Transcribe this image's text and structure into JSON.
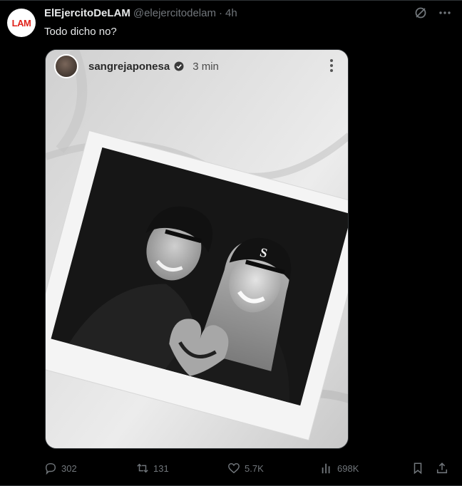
{
  "author": {
    "avatar_text": "LAM",
    "display_name": "ElEjercitoDeLAM",
    "handle": "@elejercitodelam",
    "separator": "·",
    "time": "4h"
  },
  "tweet": {
    "text": "Todo dicho no?"
  },
  "embedded_story": {
    "username": "sangrejaponesa",
    "time": "3 min"
  },
  "actions": {
    "replies": "302",
    "retweets": "131",
    "likes": "5.7K",
    "views": "698K"
  },
  "colors": {
    "background": "#000000",
    "text_primary": "#e7e9ea",
    "text_secondary": "#71767b",
    "brand_red": "#e0221a",
    "divider": "#2f3336"
  },
  "icons": {
    "top_right": [
      "grok-icon",
      "more-icon"
    ],
    "actions": [
      "reply-icon",
      "retweet-icon",
      "like-icon",
      "views-icon",
      "bookmark-icon",
      "share-icon"
    ]
  }
}
